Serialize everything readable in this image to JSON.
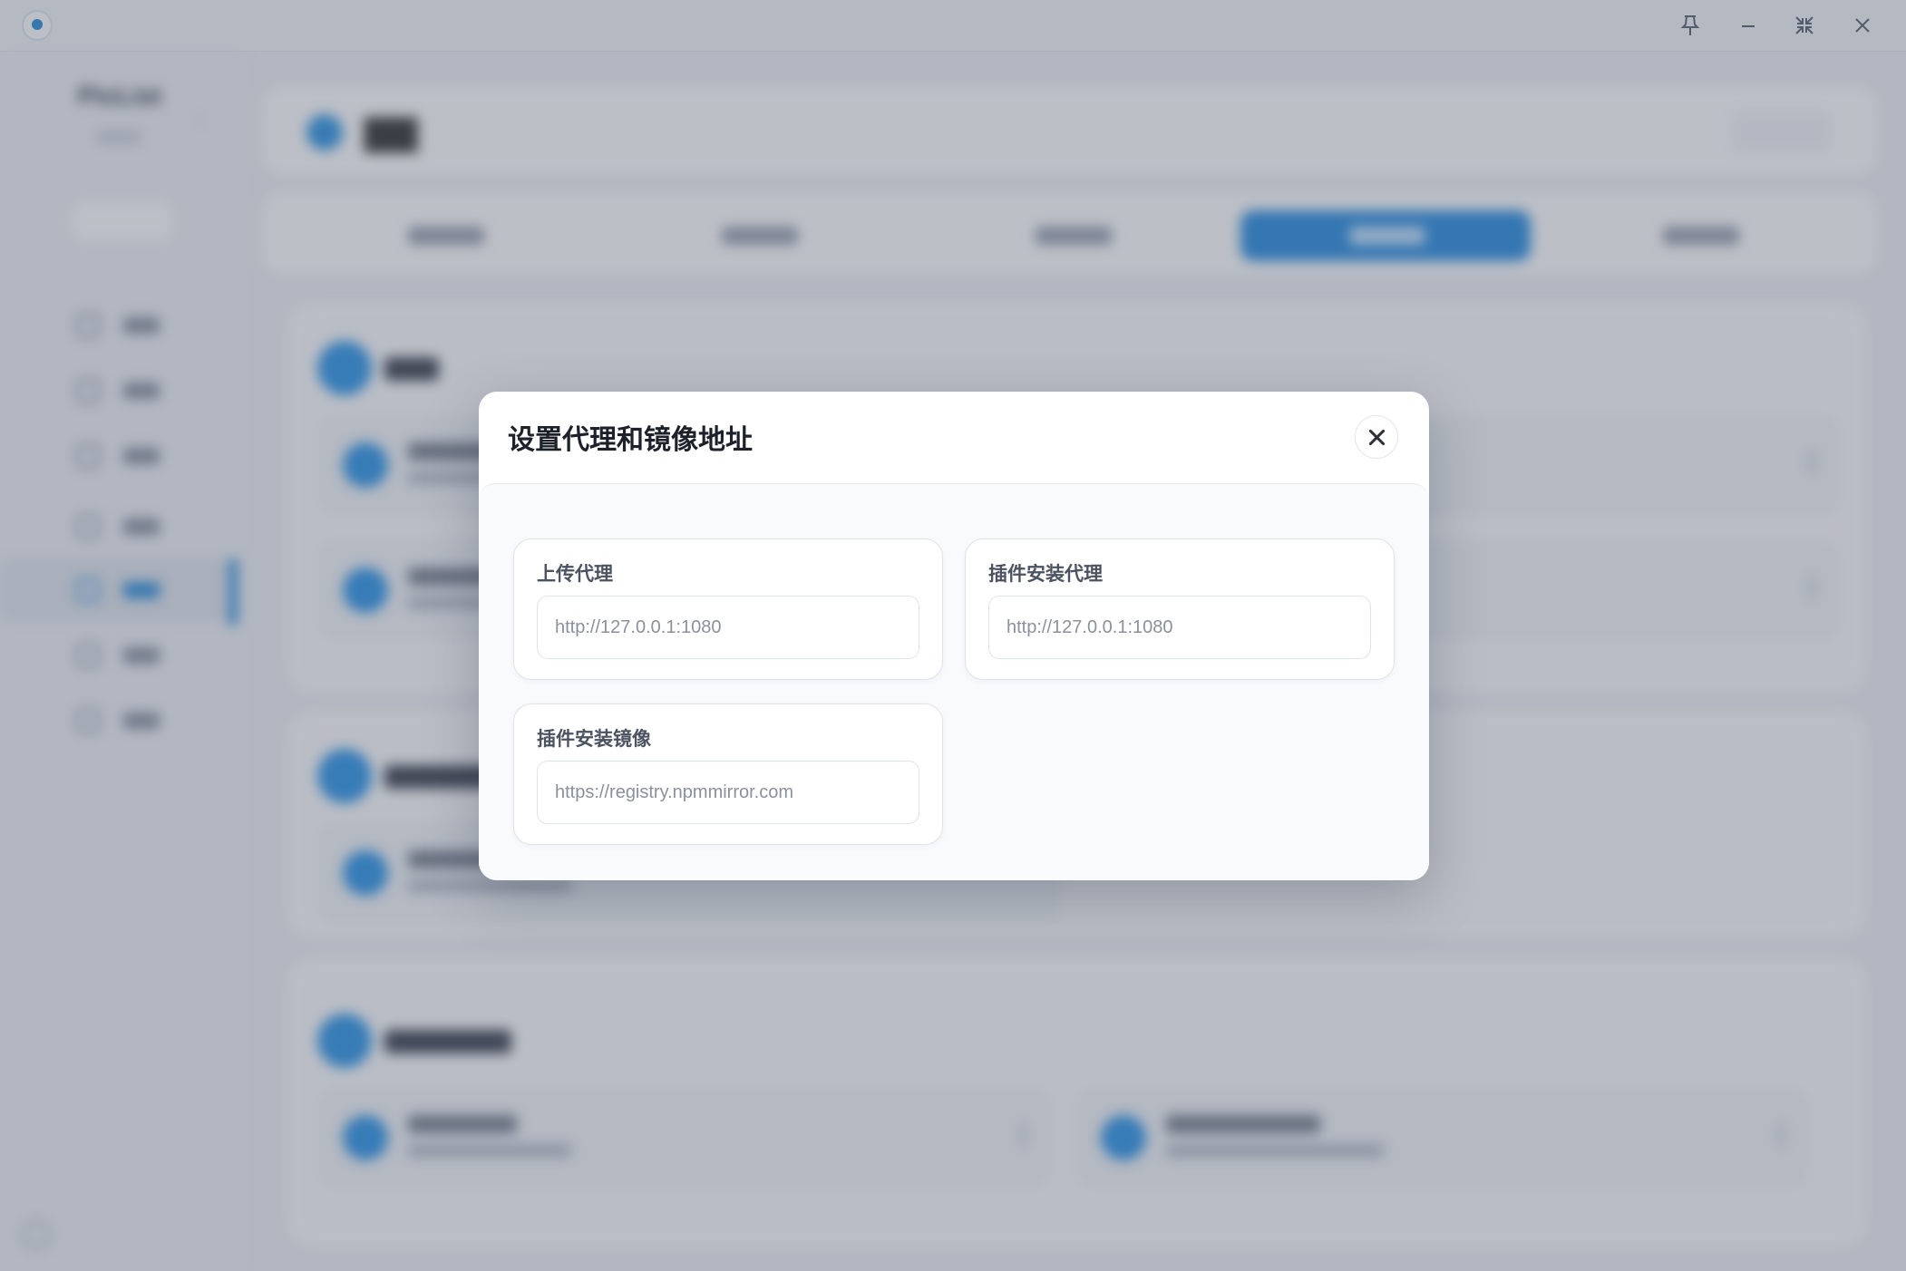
{
  "window": {
    "controls": [
      "pin-icon",
      "minimize-icon",
      "restore-icon",
      "close-icon"
    ]
  },
  "colors": {
    "accent": "#1683de",
    "overlay": "rgba(95,103,118,0.42)"
  },
  "modal": {
    "title": "设置代理和镜像地址",
    "fields": [
      {
        "label": "上传代理",
        "placeholder": "http://127.0.0.1:1080",
        "value": ""
      },
      {
        "label": "插件安装代理",
        "placeholder": "http://127.0.0.1:1080",
        "value": ""
      },
      {
        "label": "插件安装镜像",
        "placeholder": "https://registry.npmmirror.com",
        "value": ""
      }
    ]
  }
}
